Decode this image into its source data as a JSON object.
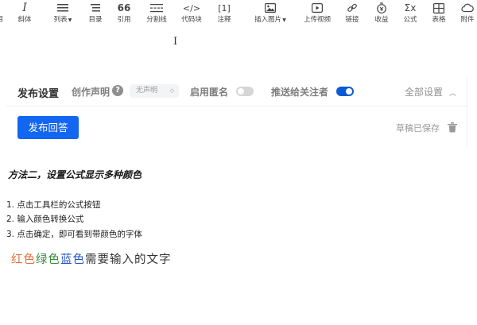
{
  "toolbar": {
    "items": [
      {
        "label": "斜体",
        "icon": "italic-icon"
      },
      {
        "label": "列表",
        "icon": "list-icon",
        "dropdown": true
      },
      {
        "label": "目录",
        "icon": "toc-icon"
      },
      {
        "label": "引用",
        "icon": "quote-icon"
      },
      {
        "label": "分割线",
        "icon": "divider-icon"
      },
      {
        "label": "代码块",
        "icon": "code-icon"
      },
      {
        "label": "注释",
        "icon": "annotation-icon"
      },
      {
        "label": "插入图片",
        "icon": "image-icon",
        "dropdown": true
      },
      {
        "label": "上传视频",
        "icon": "video-icon"
      },
      {
        "label": "链接",
        "icon": "link-icon"
      },
      {
        "label": "收益",
        "icon": "income-icon"
      },
      {
        "label": "公式",
        "icon": "formula-icon"
      },
      {
        "label": "表格",
        "icon": "table-icon"
      },
      {
        "label": "附件",
        "icon": "cloud-icon"
      }
    ],
    "glyph_quote": "66",
    "glyph_code": "</>",
    "glyph_annotation": "[1]",
    "glyph_formula": "Σx"
  },
  "publish": {
    "title": "发布设置",
    "declaration_label": "创作声明",
    "help_glyph": "?",
    "declaration_value": "无声明",
    "anonymous_label": "启用匿名",
    "anonymous_on": false,
    "push_label": "推送给关注者",
    "push_on": true,
    "all_settings": "全部设置",
    "submit_label": "发布回答",
    "draft_status": "草稿已保存",
    "accent": "#1266f1"
  },
  "doc": {
    "heading": "方法二，设置公式显示多种颜色",
    "steps": [
      "1. 点击工具栏的公式按钮",
      "2. 输入颜色转换公式",
      "3. 点击确定，即可看到带颜色的字体"
    ],
    "colored_text": [
      {
        "text": "红色",
        "color": "#e2703a"
      },
      {
        "text": "绿色",
        "color": "#3c8b3c"
      },
      {
        "text": "蓝色",
        "color": "#2456c8"
      },
      {
        "text": "需要输入的文字",
        "color": "#333333"
      }
    ]
  }
}
